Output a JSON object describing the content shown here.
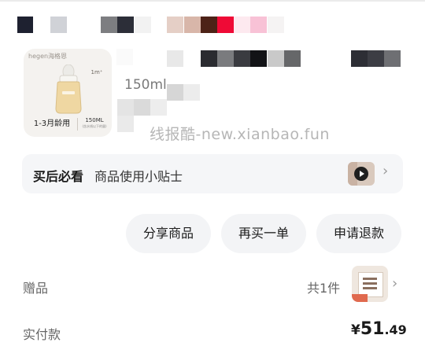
{
  "product": {
    "thumbnail": {
      "brand": "hegen海格恩",
      "badge": "1m⁺",
      "age": "1-3月龄用",
      "volume": "150ML",
      "volume_sub": "(含水线以下的量)"
    },
    "spec": "150ml"
  },
  "watermark": "线报酷-new.xianbao.fun",
  "tips": {
    "title": "买后必看",
    "description": "商品使用小贴士"
  },
  "actions": {
    "share": "分享商品",
    "buy_again": "再买一单",
    "refund": "申请退款"
  },
  "gift": {
    "label": "赠品",
    "count": "共1件"
  },
  "payment": {
    "label": "实付款",
    "currency": "¥",
    "integer": "51",
    "decimal": ".49"
  },
  "icons": {
    "tips_arrow": "chevron-right-icon",
    "gift_arrow": "chevron-right-icon",
    "video": "play-icon"
  }
}
